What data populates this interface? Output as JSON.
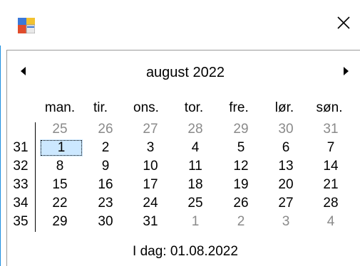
{
  "window": {
    "close_glyph": "✕"
  },
  "calendar": {
    "month_title": "august 2022",
    "day_names": [
      "man.",
      "tir.",
      "ons.",
      "tor.",
      "fre.",
      "lør.",
      "søn."
    ],
    "weeks": [
      {
        "week": "",
        "days": [
          "25",
          "26",
          "27",
          "28",
          "29",
          "30",
          "31"
        ],
        "muted": [
          true,
          true,
          true,
          true,
          true,
          true,
          true
        ]
      },
      {
        "week": "31",
        "days": [
          "1",
          "2",
          "3",
          "4",
          "5",
          "6",
          "7"
        ],
        "muted": [
          false,
          false,
          false,
          false,
          false,
          false,
          false
        ]
      },
      {
        "week": "32",
        "days": [
          "8",
          "9",
          "10",
          "11",
          "12",
          "13",
          "14"
        ],
        "muted": [
          false,
          false,
          false,
          false,
          false,
          false,
          false
        ]
      },
      {
        "week": "33",
        "days": [
          "15",
          "16",
          "17",
          "18",
          "19",
          "20",
          "21"
        ],
        "muted": [
          false,
          false,
          false,
          false,
          false,
          false,
          false
        ]
      },
      {
        "week": "34",
        "days": [
          "22",
          "23",
          "24",
          "25",
          "26",
          "27",
          "28"
        ],
        "muted": [
          false,
          false,
          false,
          false,
          false,
          false,
          false
        ]
      },
      {
        "week": "35",
        "days": [
          "29",
          "30",
          "31",
          "1",
          "2",
          "3",
          "4"
        ],
        "muted": [
          false,
          false,
          false,
          true,
          true,
          true,
          true
        ]
      }
    ],
    "selected_day": "1",
    "today_text": "I dag: 01.08.2022"
  },
  "colors": {
    "selection": "#cce8ff",
    "muted": "#8a8a8a",
    "window_border": "#1e90e0"
  },
  "icons": {
    "app": "app-icon",
    "close": "close-icon",
    "prev": "prev-month-icon",
    "next": "next-month-icon"
  }
}
